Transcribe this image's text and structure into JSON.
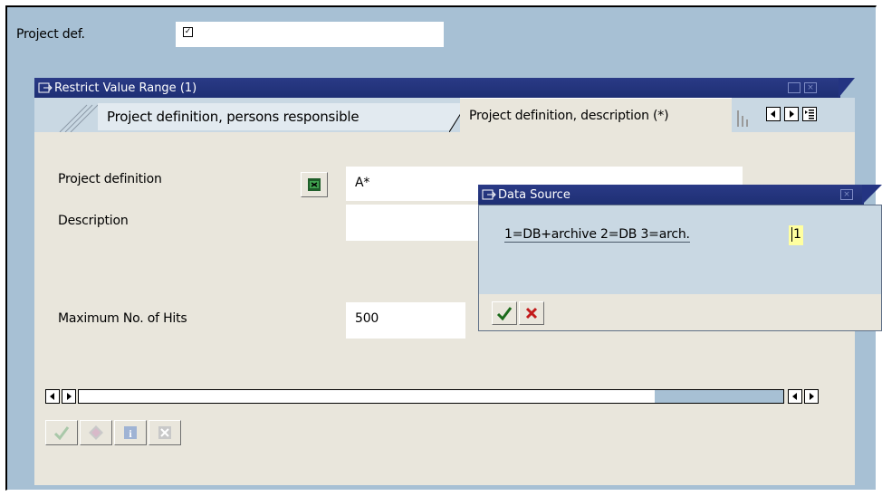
{
  "main": {
    "project_def_label": "Project def.",
    "project_def_value": ""
  },
  "restrict_dialog": {
    "title": "Restrict Value Range (1)",
    "tabs": [
      {
        "label": "Project definition, persons responsible",
        "active": false
      },
      {
        "label": "Project definition, description (*)",
        "active": true
      }
    ],
    "fields": {
      "project_definition_label": "Project definition",
      "project_definition_value": "A*",
      "description_label": "Description",
      "description_value": "",
      "max_hits_label": "Maximum No. of Hits",
      "max_hits_value": "500"
    },
    "toolbar": [
      "check-icon",
      "multiple-selection-icon",
      "info-icon",
      "cancel-icon"
    ]
  },
  "data_source_dialog": {
    "title": "Data Source",
    "prompt_label": "1=DB+archive 2=DB 3=arch.",
    "prompt_value": "1",
    "buttons": [
      "confirm-check-icon",
      "cancel-x-icon"
    ]
  },
  "colors": {
    "titlebar": "#243482",
    "workspace": "#a7c0d4",
    "dialog_body": "#e9e6dc",
    "tab_strip": "#c9d8e3",
    "input_highlight": "#ffffa0"
  }
}
